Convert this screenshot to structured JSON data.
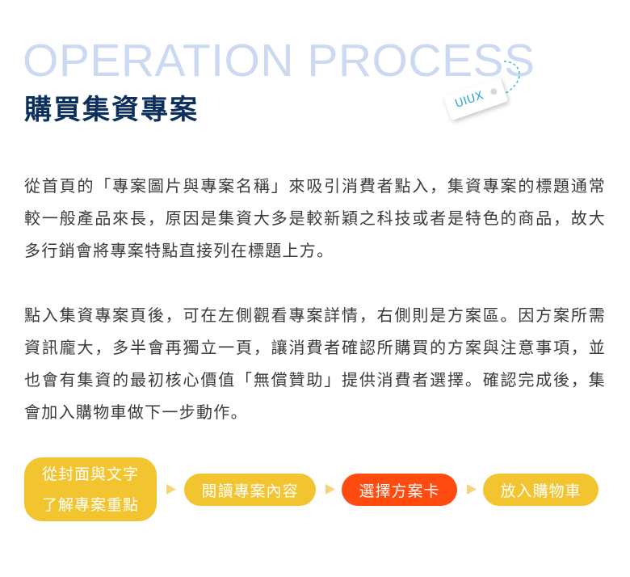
{
  "header": {
    "en_title": "OPERATION PROCESS",
    "zh_title": "購買集資專案",
    "tag_label": "UIUX"
  },
  "paragraphs": [
    "從首頁的「專案圖片與專案名稱」來吸引消費者點入，集資專案的標題通常較一般產品來長，原因是集資大多是較新穎之科技或者是特色的商品，故大多行銷會將專案特點直接列在標題上方。",
    "點入集資專案頁後，可在左側觀看專案詳情，右側則是方案區。因方案所需資訊龐大，多半會再獨立一頁，讓消費者確認所購買的方案與注意事項，並也會有集資的最初核心價值「無償贊助」提供消費者選擇。確認完成後，集會加入購物車做下一步動作。"
  ],
  "flow": {
    "step1_line1": "從封面與文字",
    "step1_line2": "了解專案重點",
    "step2": "閱讀專案內容",
    "step3": "選擇方案卡",
    "step4": "放入購物車"
  },
  "colors": {
    "en_title": "#ccd9f2",
    "zh_title": "#0c2f5c",
    "tag_text": "#2aa7d1",
    "step_default": "#f2c430",
    "step_active": "#ff4b0f",
    "arrow": "#f2d67a",
    "body_text": "#3a3a3a"
  },
  "icons": {
    "flow_arrow": "triangle-right-icon",
    "tag_string": "dashed-string-icon"
  }
}
